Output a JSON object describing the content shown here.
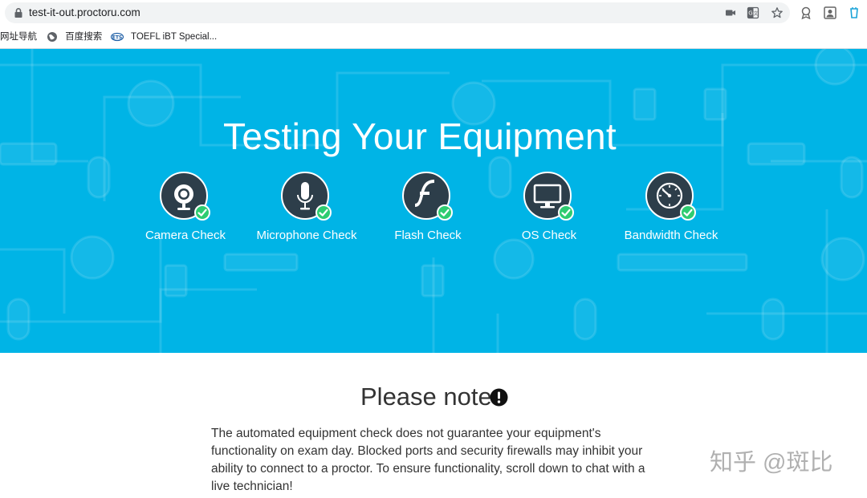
{
  "browser": {
    "url": "test-it-out.proctoru.com",
    "bookmarks": [
      {
        "label": "网址导航"
      },
      {
        "label": "百度搜索"
      },
      {
        "label": "TOEFL iBT Special..."
      }
    ]
  },
  "hero": {
    "title": "Testing Your Equipment",
    "background_color": "#00b4e6",
    "checks": [
      {
        "label": "Camera Check",
        "icon": "webcam-icon",
        "status": "passed"
      },
      {
        "label": "Microphone Check",
        "icon": "microphone-icon",
        "status": "passed"
      },
      {
        "label": "Flash Check",
        "icon": "flash-icon",
        "status": "passed"
      },
      {
        "label": "OS Check",
        "icon": "monitor-icon",
        "status": "passed"
      },
      {
        "label": "Bandwidth Check",
        "icon": "speedometer-icon",
        "status": "passed"
      }
    ],
    "check_success_color": "#2ecc71"
  },
  "note": {
    "title": "Please note",
    "body": "The automated equipment check does not guarantee your equipment's functionality on exam day. Blocked ports and security firewalls may inhibit your ability to connect to a proctor. To ensure functionality, scroll down to chat with a live technician!"
  },
  "watermark": {
    "text": "知乎 @斑比"
  }
}
